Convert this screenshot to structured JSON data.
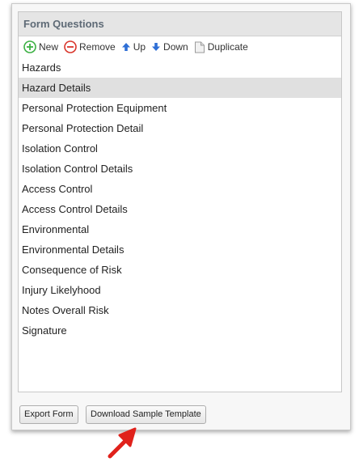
{
  "panel": {
    "title": "Form Questions"
  },
  "toolbar": {
    "new_label": "New",
    "remove_label": "Remove",
    "up_label": "Up",
    "down_label": "Down",
    "duplicate_label": "Duplicate",
    "icons": {
      "new": "plus-circle-icon",
      "remove": "minus-circle-icon",
      "up": "arrow-up-icon",
      "down": "arrow-down-icon",
      "duplicate": "duplicate-document-icon"
    }
  },
  "questions": {
    "selected_index": 1,
    "items": [
      "Hazards",
      "Hazard Details",
      "Personal Protection Equipment",
      "Personal Protection Detail",
      "Isolation Control",
      "Isolation Control Details",
      "Access Control",
      "Access Control Details",
      "Environmental",
      "Environmental Details",
      "Consequence of Risk",
      "Injury Likelyhood",
      "Notes Overall Risk",
      "Signature"
    ]
  },
  "footer": {
    "export_label": "Export Form",
    "download_label": "Download Sample Template"
  },
  "colors": {
    "new_icon": "#3cb043",
    "remove_icon": "#d9352b",
    "arrow_icon": "#2f6fd6",
    "callout_arrow": "#e0211b",
    "selected_row": "#e0e0e0",
    "header_text": "#5e6a76"
  }
}
